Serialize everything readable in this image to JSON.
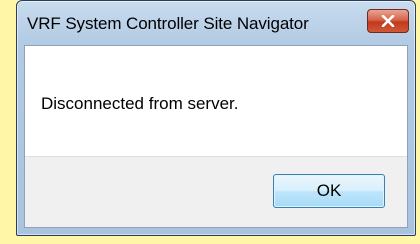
{
  "window": {
    "title": "VRF System Controller  Site Navigator",
    "close_icon": "close-icon"
  },
  "body": {
    "message": "Disconnected from server."
  },
  "footer": {
    "ok_label": "OK"
  },
  "colors": {
    "background": "#fff6a8",
    "frame": "#b3cbe4",
    "close_button": "#c2391b",
    "ok_border": "#3c7fb1",
    "footer": "#f0f0f0"
  }
}
